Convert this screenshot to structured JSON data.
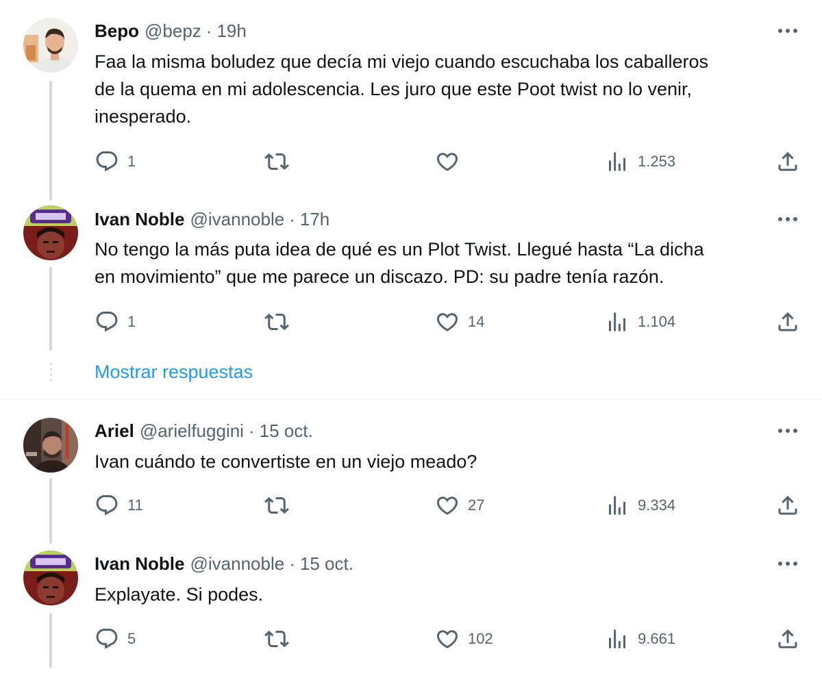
{
  "tweets": [
    {
      "name": "Bepo",
      "handle": "@bepz",
      "separator": "·",
      "time": "19h",
      "text_lines": [
        "Faa la misma boludez que decía mi viejo cuando escuchaba los caballeros",
        "de la quema en mi adolescencia. Les juro que este Poot twist no lo venir,",
        "inesperado."
      ],
      "replies": "1",
      "retweets": "",
      "likes": "",
      "views": "1.253"
    },
    {
      "name": "Ivan Noble",
      "handle": "@ivannoble",
      "separator": "·",
      "time": "17h",
      "text_lines": [
        "No tengo la más puta idea de qué es un Plot Twist. Llegué hasta “La dicha",
        "en movimiento” que me parece un discazo. PD: su padre tenía razón."
      ],
      "replies": "1",
      "retweets": "",
      "likes": "14",
      "views": "1.104"
    },
    {
      "name": "Ariel",
      "handle": "@arielfuggini",
      "separator": "·",
      "time": "15 oct.",
      "text_lines": [
        "Ivan cuándo te convertiste en un viejo meado?"
      ],
      "replies": "11",
      "retweets": "",
      "likes": "27",
      "views": "9.334"
    },
    {
      "name": "Ivan Noble",
      "handle": "@ivannoble",
      "separator": "·",
      "time": "15 oct.",
      "text_lines": [
        "Explayate. Si podes."
      ],
      "replies": "5",
      "retweets": "",
      "likes": "102",
      "views": "9.661"
    }
  ],
  "show_replies_label": "Mostrar respuestas",
  "icons": [
    "more-icon",
    "reply-icon",
    "retweet-icon",
    "like-icon",
    "views-icon",
    "share-icon"
  ],
  "colors": {
    "text": "#0f1419",
    "secondary": "#536471",
    "link": "#1d9bf0",
    "thread_line": "#cfd9de",
    "divider": "#eff3f4"
  }
}
